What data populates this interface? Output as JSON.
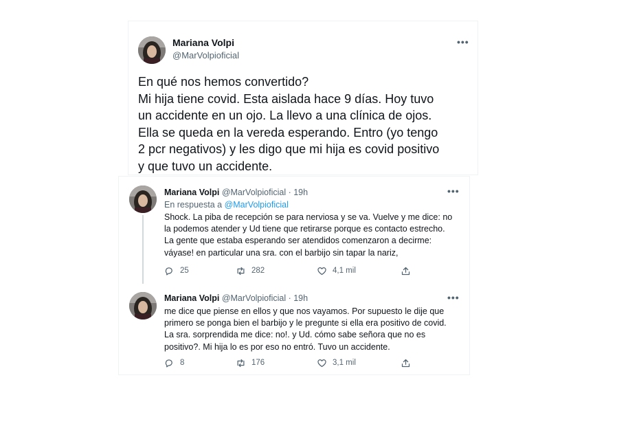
{
  "main_tweet": {
    "author_name": "Mariana Volpi",
    "author_handle": "@MarVolpioficial",
    "lines": [
      "En qué nos hemos convertido?",
      "Mi hija tiene covid. Esta aislada hace 9 días. Hoy tuvo",
      "un accidente en un ojo. La llevo a una clínica de ojos.",
      "Ella se queda en la vereda esperando. Entro (yo tengo",
      "2 pcr negativos) y les digo que mi hija es covid positivo",
      "y que tuvo un accidente."
    ]
  },
  "replies": [
    {
      "author_name": "Mariana Volpi",
      "author_handle": "@MarVolpioficial",
      "time": "· 19h",
      "reply_prefix": "En respuesta a",
      "reply_target": "@MarVolpioficial",
      "lines": [
        "Shock. La piba de recepción se para nerviosa y se va. Vuelve y me dice: no",
        "la podemos atender y Ud tiene que retirarse porque es contacto estrecho.",
        "La gente que estaba esperando ser atendidos comenzaron a decirme:",
        "váyase! en particular una sra. con el barbijo sin tapar la nariz,"
      ],
      "replies_count": "25",
      "retweets_count": "282",
      "likes_count": "4,1 mil"
    },
    {
      "author_name": "Mariana Volpi",
      "author_handle": "@MarVolpioficial",
      "time": "· 19h",
      "lines": [
        "me dice que piense en ellos y que nos vayamos. Por supuesto le dije que",
        "primero se ponga bien el barbijo y le pregunte si ella era positivo de covid.",
        "La sra. sorprendida me dice: no!. y Ud. cómo sabe señora que no es",
        "positivo?. Mi hija lo es por eso no entró. Tuvo un accidente."
      ],
      "replies_count": "8",
      "retweets_count": "176",
      "likes_count": "3,1 mil"
    }
  ],
  "icons": {
    "more": "more-horizontal-icon",
    "reply": "reply-bubble-icon",
    "retweet": "retweet-icon",
    "like": "heart-icon",
    "share": "share-upload-icon"
  },
  "colors": {
    "text": "#0f1419",
    "secondary": "#536471",
    "link": "#1d9bf0",
    "border": "#eff3f4"
  }
}
